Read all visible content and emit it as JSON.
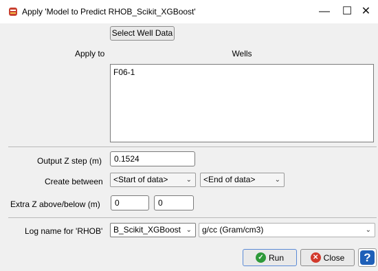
{
  "window": {
    "title": "Apply 'Model to Predict RHOB_Scikit_XGBoost'",
    "minimize_glyph": "—",
    "maximize_glyph": "☐",
    "close_glyph": "✕"
  },
  "select_well_button": "Select Well Data",
  "apply_to_label": "Apply to",
  "wells": {
    "header": "Wells",
    "items": [
      "F06-1"
    ]
  },
  "output_z": {
    "label": "Output Z step (m)",
    "value": "0.1524"
  },
  "create_between": {
    "label": "Create between",
    "start": "<Start of data>",
    "end": "<End of data>"
  },
  "extra_z": {
    "label": "Extra Z above/below (m)",
    "above": "0",
    "below": "0"
  },
  "log_name": {
    "label": "Log name for 'RHOB'",
    "value": "RHOB_Scikit_XGBoost",
    "unit": "g/cc (Gram/cm3)"
  },
  "buttons": {
    "run": "Run",
    "close": "Close",
    "help": "?"
  },
  "icons": {
    "app": "app-icon",
    "run": "check-circle-icon",
    "close": "x-circle-icon",
    "help": "help-icon",
    "dropdown": "chevron-down-icon"
  }
}
